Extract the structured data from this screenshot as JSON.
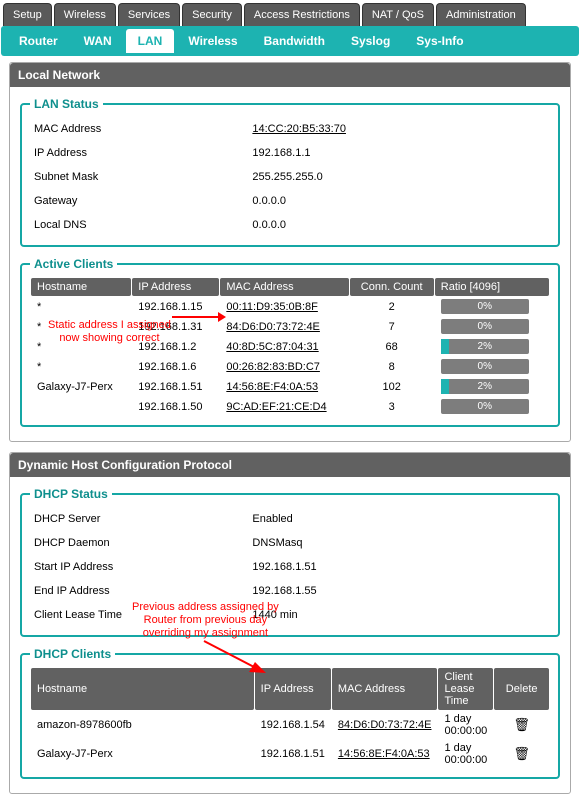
{
  "tabs": [
    "Setup",
    "Wireless",
    "Services",
    "Security",
    "Access Restrictions",
    "NAT / QoS",
    "Administration"
  ],
  "subtabs": {
    "items": [
      "Router",
      "WAN",
      "LAN",
      "Wireless",
      "Bandwidth",
      "Syslog",
      "Sys-Info"
    ],
    "active": 2
  },
  "sections": {
    "local_network": "Local Network",
    "dhcp": "Dynamic Host Configuration Protocol"
  },
  "lan_status": {
    "legend": "LAN Status",
    "rows": [
      {
        "label": "MAC Address",
        "value": "14:CC:20:B5:33:70",
        "link": true
      },
      {
        "label": "IP Address",
        "value": "192.168.1.1"
      },
      {
        "label": "Subnet Mask",
        "value": "255.255.255.0"
      },
      {
        "label": "Gateway",
        "value": "0.0.0.0"
      },
      {
        "label": "Local DNS",
        "value": "0.0.0.0"
      }
    ]
  },
  "active_clients": {
    "legend": "Active Clients",
    "headers": [
      "Hostname",
      "IP Address",
      "MAC Address",
      "Conn. Count",
      "Ratio [4096]"
    ],
    "rows": [
      {
        "host": "*",
        "ip": "192.168.1.15",
        "mac": "00:11:D9:35:0B:8F",
        "conn": "2",
        "ratio_pct": 0,
        "ratio_label": "0%"
      },
      {
        "host": "*",
        "ip": "192.168.1.31",
        "mac": "84:D6:D0:73:72:4E",
        "conn": "7",
        "ratio_pct": 0,
        "ratio_label": "0%"
      },
      {
        "host": "*",
        "ip": "192.168.1.2",
        "mac": "40:8D:5C:87:04:31",
        "conn": "68",
        "ratio_pct": 2,
        "ratio_label": "2%"
      },
      {
        "host": "*",
        "ip": "192.168.1.6",
        "mac": "00:26:82:83:BD:C7",
        "conn": "8",
        "ratio_pct": 0,
        "ratio_label": "0%"
      },
      {
        "host": "Galaxy-J7-Perx",
        "ip": "192.168.1.51",
        "mac": "14:56:8E:F4:0A:53",
        "conn": "102",
        "ratio_pct": 2,
        "ratio_label": "2%"
      },
      {
        "host": "",
        "ip": "192.168.1.50",
        "mac": "9C:AD:EF:21:CE:D4",
        "conn": "3",
        "ratio_pct": 0,
        "ratio_label": "0%"
      }
    ]
  },
  "dhcp_status": {
    "legend": "DHCP Status",
    "rows": [
      {
        "label": "DHCP Server",
        "value": "Enabled"
      },
      {
        "label": "DHCP Daemon",
        "value": "DNSMasq"
      },
      {
        "label": "Start IP Address",
        "value": "192.168.1.51"
      },
      {
        "label": "End IP Address",
        "value": "192.168.1.55"
      },
      {
        "label": "Client Lease Time",
        "value": "1440 min"
      }
    ]
  },
  "dhcp_clients": {
    "legend": "DHCP Clients",
    "headers": [
      "Hostname",
      "IP Address",
      "MAC Address",
      "Client Lease Time",
      "Delete"
    ],
    "rows": [
      {
        "host": "amazon-8978600fb",
        "ip": "192.168.1.54",
        "mac": "84:D6:D0:73:72:4E",
        "lease": "1 day 00:00:00"
      },
      {
        "host": "Galaxy-J7-Perx",
        "ip": "192.168.1.51",
        "mac": "14:56:8E:F4:0A:53",
        "lease": "1 day 00:00:00"
      }
    ]
  },
  "annotations": {
    "a1_l1": "Static address I assigned",
    "a1_l2": "now showing correct",
    "a2_l1": "Previous address assigned by",
    "a2_l2": "Router from previous day",
    "a2_l3": "overriding my assignment"
  },
  "icons": {
    "trash": "🗑"
  }
}
